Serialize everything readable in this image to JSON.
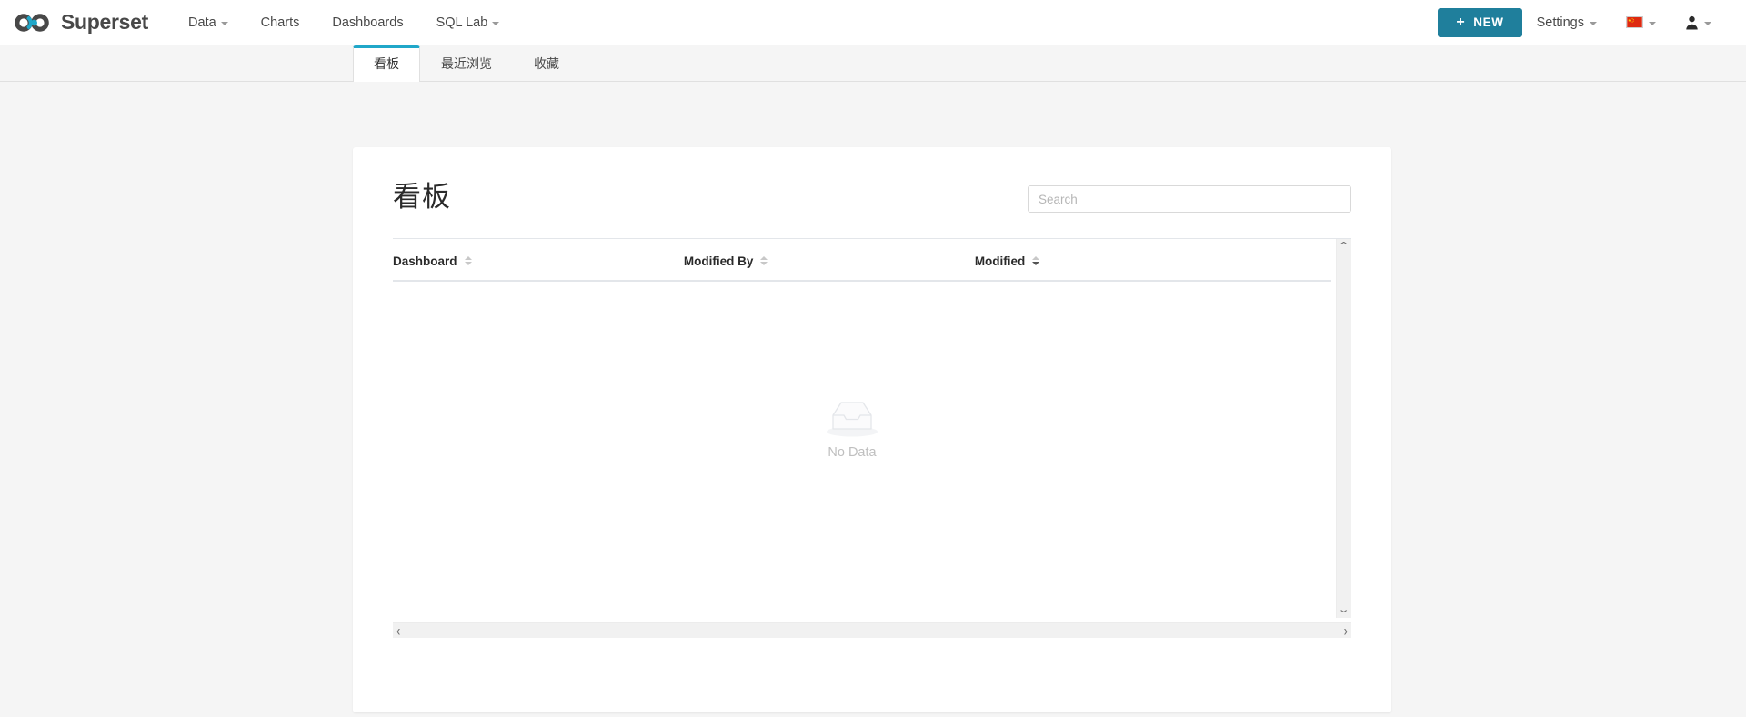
{
  "navbar": {
    "brand": "Superset",
    "links": [
      {
        "label": "Data",
        "has_caret": true
      },
      {
        "label": "Charts",
        "has_caret": false
      },
      {
        "label": "Dashboards",
        "has_caret": false
      },
      {
        "label": "SQL Lab",
        "has_caret": true
      }
    ],
    "new_button": {
      "label": "NEW",
      "plus": "+",
      "color": "#1f7f9c"
    },
    "settings": {
      "label": "Settings",
      "has_caret": true
    },
    "language": {
      "icon": "china-flag-icon",
      "has_caret": true
    },
    "user": {
      "icon": "user-icon",
      "has_caret": true
    }
  },
  "tabs": [
    {
      "label": "看板",
      "active": true
    },
    {
      "label": "最近浏览",
      "active": false
    },
    {
      "label": "收藏",
      "active": false
    }
  ],
  "main": {
    "title": "看板",
    "search": {
      "placeholder": "Search",
      "value": ""
    },
    "table": {
      "columns": [
        {
          "label": "Dashboard",
          "sort": "none"
        },
        {
          "label": "Modified By",
          "sort": "none"
        },
        {
          "label": "Modified",
          "sort": "desc"
        }
      ],
      "rows": [],
      "empty": {
        "text": "No Data",
        "icon": "empty-box-icon"
      }
    }
  },
  "scrollbars": {
    "vertical": {
      "up": "⌃",
      "down": "⌄"
    },
    "horizontal": {
      "left": "‹",
      "right": "›"
    }
  },
  "colors": {
    "accent": "#20a7c9",
    "primary_button": "#1f7f9c",
    "page_background": "#f5f5f5",
    "card_background": "#ffffff"
  }
}
